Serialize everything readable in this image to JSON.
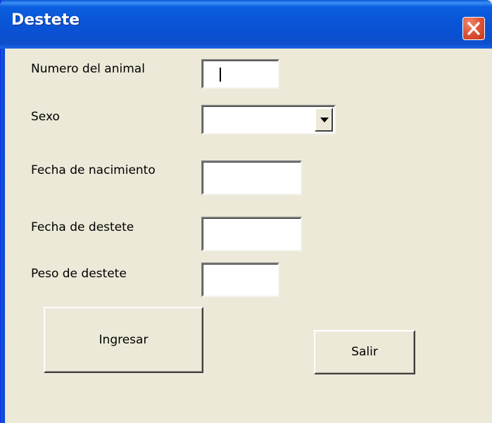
{
  "window": {
    "title": "Destete",
    "close_icon": "close-icon",
    "accent_color": "#0a56d8",
    "close_color": "#e0553a"
  },
  "form": {
    "animal_number": {
      "label": "Numero del animal",
      "value": ""
    },
    "sex": {
      "label": "Sexo",
      "value": "",
      "dropdown_icon": "chevron-down-icon"
    },
    "birth_date": {
      "label": "Fecha de nacimiento",
      "value": ""
    },
    "weaning_date": {
      "label": "Fecha de destete",
      "value": ""
    },
    "weaning_weight": {
      "label": "Peso de destete",
      "value": ""
    }
  },
  "buttons": {
    "submit": "Ingresar",
    "exit": "Salir"
  }
}
